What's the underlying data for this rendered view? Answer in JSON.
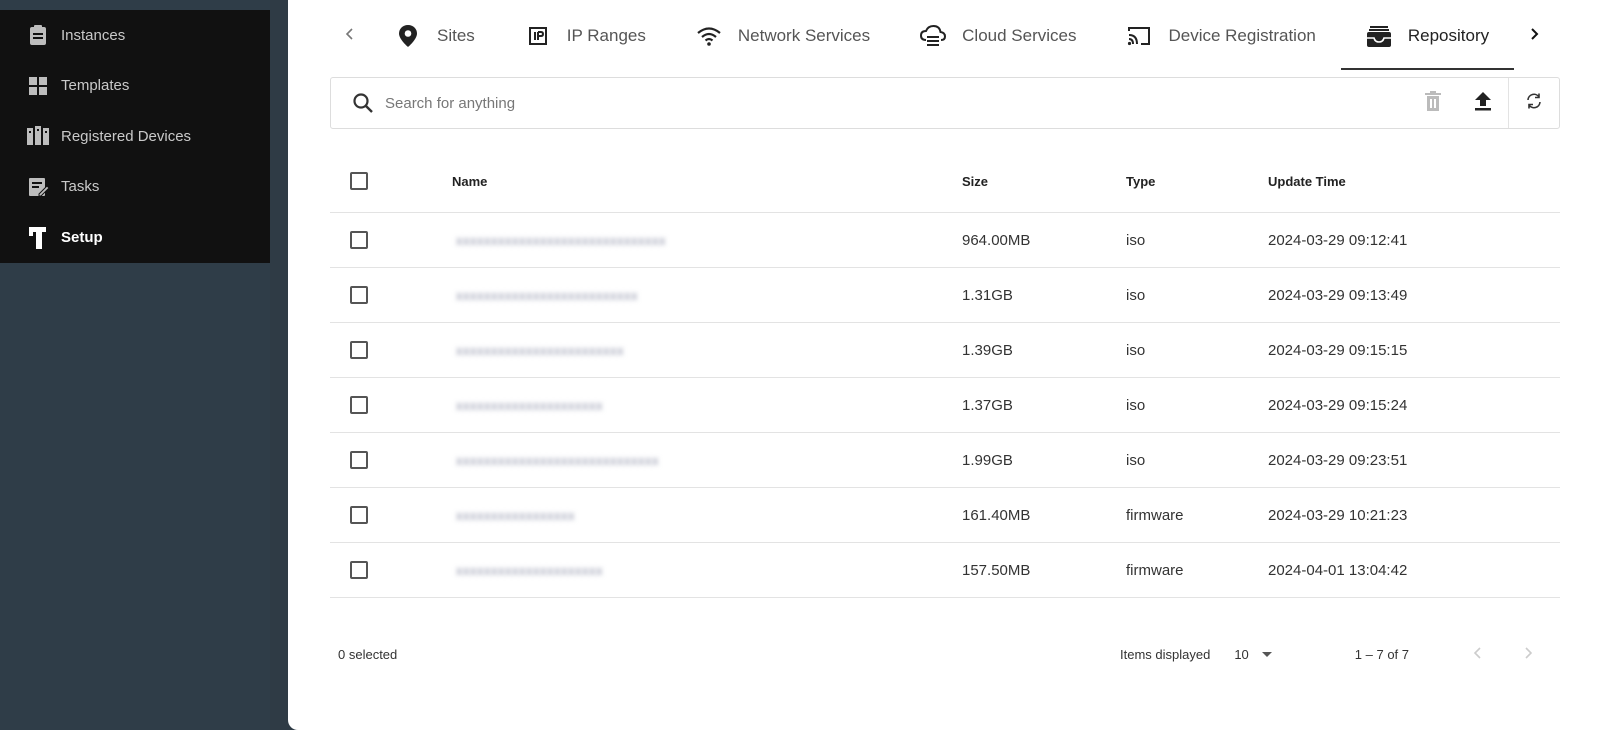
{
  "sidebar": {
    "items": [
      {
        "label": "Instances",
        "icon": "clipboard-icon",
        "active": false
      },
      {
        "label": "Templates",
        "icon": "grid-icon",
        "active": false
      },
      {
        "label": "Registered Devices",
        "icon": "devices-icon",
        "active": false
      },
      {
        "label": "Tasks",
        "icon": "edit-task-icon",
        "active": false
      },
      {
        "label": "Setup",
        "icon": "brand-logo-icon",
        "active": true
      }
    ]
  },
  "tabs": [
    {
      "label": "Sites",
      "icon": "location-pin-icon",
      "active": false
    },
    {
      "label": "IP Ranges",
      "icon": "ip-icon",
      "active": false
    },
    {
      "label": "Network Services",
      "icon": "wifi-icon",
      "active": false
    },
    {
      "label": "Cloud Services",
      "icon": "cloud-icon",
      "active": false
    },
    {
      "label": "Device Registration",
      "icon": "cast-icon",
      "active": false
    },
    {
      "label": "Repository",
      "icon": "inbox-tray-icon",
      "active": true
    }
  ],
  "search": {
    "placeholder": "Search for anything",
    "value": ""
  },
  "table": {
    "headers": {
      "name": "Name",
      "size": "Size",
      "type": "Type",
      "update_time": "Update Time"
    },
    "rows": [
      {
        "name": "xxxxxxxxxxxxxxxxxxxxxxxxxxxxxx",
        "size": "964.00MB",
        "type": "iso",
        "update_time": "2024-03-29 09:12:41"
      },
      {
        "name": "xxxxxxxxxxxxxxxxxxxxxxxxxx",
        "size": "1.31GB",
        "type": "iso",
        "update_time": "2024-03-29 09:13:49"
      },
      {
        "name": "xxxxxxxxxxxxxxxxxxxxxxxx",
        "size": "1.39GB",
        "type": "iso",
        "update_time": "2024-03-29 09:15:15"
      },
      {
        "name": "xxxxxxxxxxxxxxxxxxxxx",
        "size": "1.37GB",
        "type": "iso",
        "update_time": "2024-03-29 09:15:24"
      },
      {
        "name": "xxxxxxxxxxxxxxxxxxxxxxxxxxxxx",
        "size": "1.99GB",
        "type": "iso",
        "update_time": "2024-03-29 09:23:51"
      },
      {
        "name": "xxxxxxxxxxxxxxxxx",
        "size": "161.40MB",
        "type": "firmware",
        "update_time": "2024-03-29 10:21:23"
      },
      {
        "name": "xxxxxxxxxxxxxxxxxxxxx",
        "size": "157.50MB",
        "type": "firmware",
        "update_time": "2024-04-01 13:04:42"
      }
    ]
  },
  "footer": {
    "selected": "0 selected",
    "items_label": "Items displayed",
    "page_size": "10",
    "range": "1 – 7 of 7"
  },
  "colors": {
    "sidebar_bg": "#2f3d48",
    "menu_bg": "#111111",
    "accent": "#333333"
  }
}
